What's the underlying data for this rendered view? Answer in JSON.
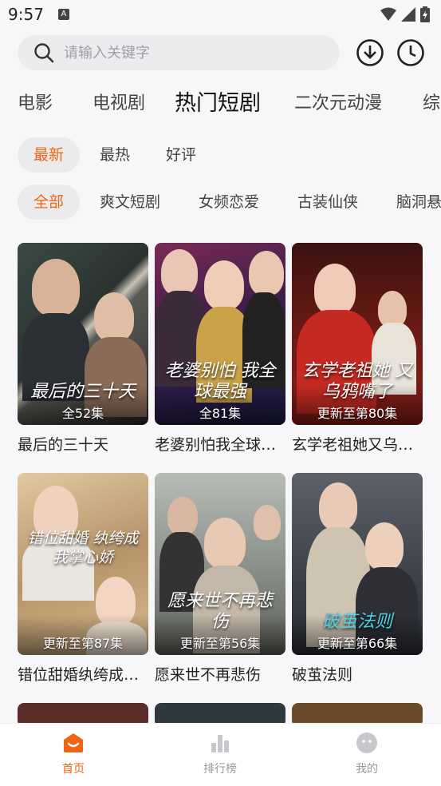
{
  "status": {
    "time": "9:57"
  },
  "search": {
    "placeholder": "请输入关键字"
  },
  "categories": [
    "电影",
    "电视剧",
    "热门短剧",
    "二次元动漫",
    "综"
  ],
  "sort_tabs": [
    "最新",
    "最热",
    "好评"
  ],
  "genres": [
    "全部",
    "爽文短剧",
    "女频恋爱",
    "古装仙侠",
    "脑洞悬"
  ],
  "cards": [
    {
      "name": "最后的三十天",
      "badge": "全52集",
      "poster_text": "最后的三十天"
    },
    {
      "name": "老婆别怕我全球…",
      "badge": "全81集",
      "poster_text": "老婆别怕 我全球最强"
    },
    {
      "name": "玄学老祖她又乌…",
      "badge": "更新至第80集",
      "poster_text": "玄学老祖她 又乌鸦嘴了"
    },
    {
      "name": "错位甜婚纨绔成…",
      "badge": "更新至第87集",
      "poster_text": "错位甜婚 纨绔成我掌心娇"
    },
    {
      "name": "愿来世不再悲伤",
      "badge": "更新至第56集",
      "poster_text": "愿来世不再悲伤"
    },
    {
      "name": "破茧法则",
      "badge": "更新至第66集",
      "poster_text": "破茧法则"
    }
  ],
  "tabbar": [
    {
      "label": "首页"
    },
    {
      "label": "排行榜"
    },
    {
      "label": "我的"
    }
  ],
  "colors": {
    "accent": "#f06414",
    "chip_bg": "#ebebee",
    "page_bg": "#f7f7f9"
  }
}
